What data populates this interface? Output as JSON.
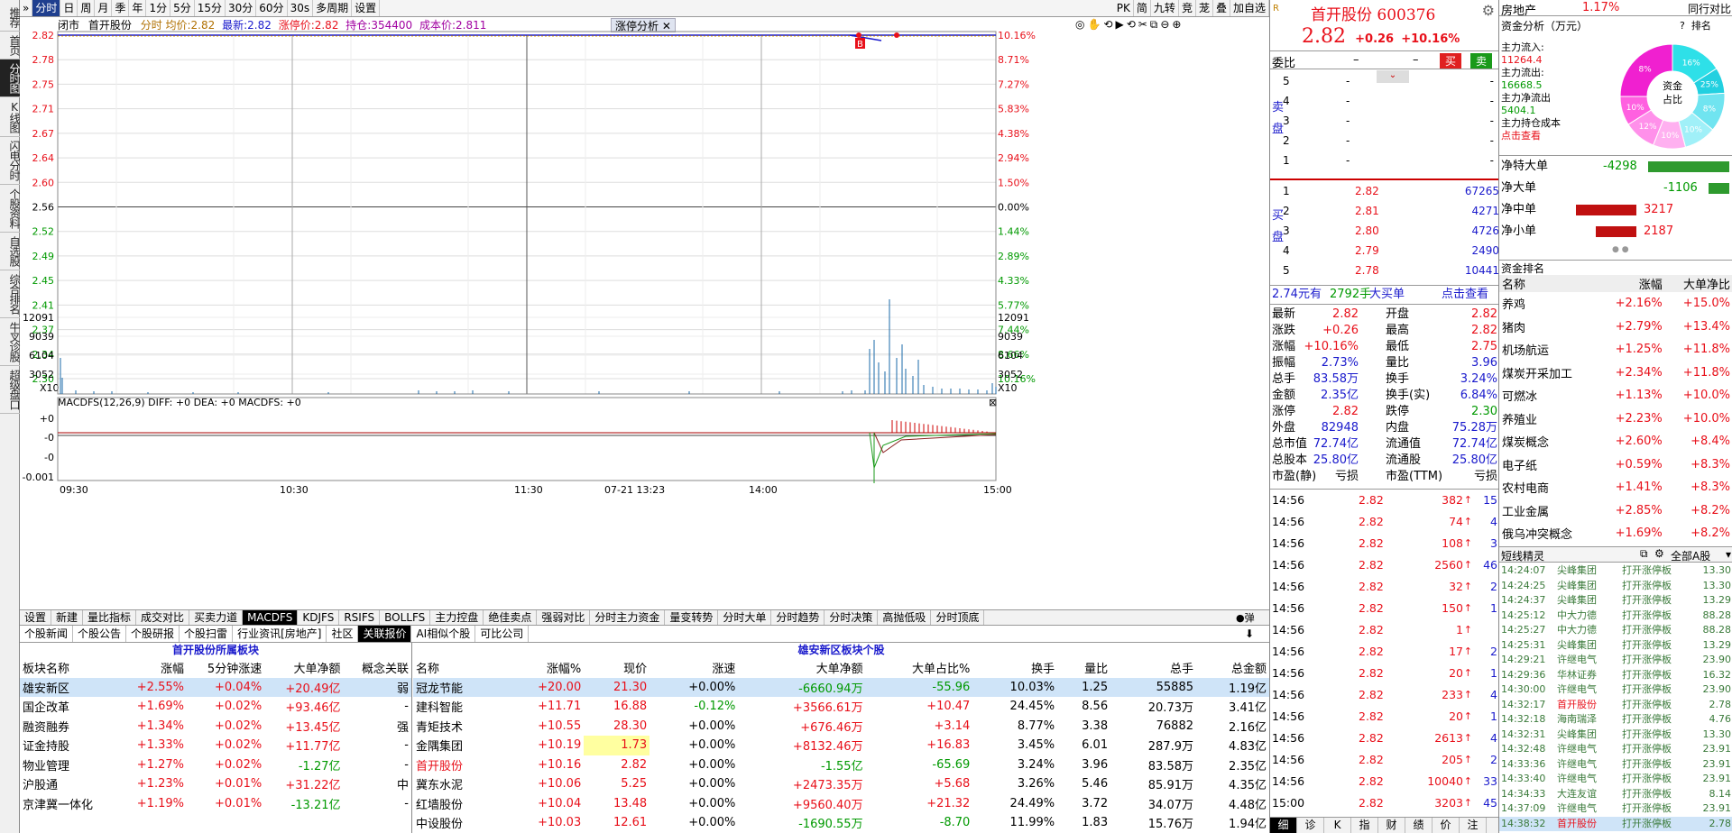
{
  "left_rail": [
    {
      "label": "推荐"
    },
    {
      "label": "首页"
    },
    {
      "label": "分时图",
      "active": true
    },
    {
      "label": "K线图"
    },
    {
      "label": "闪电分时"
    },
    {
      "label": "个股资料"
    },
    {
      "label": "自选股"
    },
    {
      "label": "综合排名"
    },
    {
      "label": "牛叉诊股"
    },
    {
      "label": "超级盘口"
    }
  ],
  "toolbar": {
    "items": [
      "分时",
      "日",
      "周",
      "月",
      "季",
      "年",
      "1分",
      "5分",
      "15分",
      "30分",
      "60分",
      "30s",
      "多周期",
      "设置"
    ],
    "right_items": [
      "PK",
      "简",
      "九转",
      "竞",
      "茏",
      "叠",
      "加自选"
    ]
  },
  "chart_header": {
    "mode": "闭市",
    "name": "首开股份",
    "avg_label": "分时 均价:",
    "avg": "2.82",
    "latest_label": "最新:",
    "latest": "2.82",
    "limit_label": "涨停价:",
    "limit": "2.82",
    "hold_label": "持仓:",
    "hold": "354400",
    "cost_label": "成本价:",
    "cost": "2.811",
    "analysis_btn": "涨停分析"
  },
  "price_axis": {
    "left": [
      "2.82",
      "2.78",
      "2.75",
      "2.71",
      "2.67",
      "2.64",
      "2.60",
      "2.56",
      "2.52",
      "2.49",
      "2.45",
      "2.41",
      "2.37",
      "2.34",
      "2.30"
    ],
    "right": [
      "10.16%",
      "8.71%",
      "7.27%",
      "5.83%",
      "4.38%",
      "2.94%",
      "1.50%",
      "0.00%",
      "1.44%",
      "2.89%",
      "4.33%",
      "5.77%",
      "7.44%",
      "8.66%",
      "10.16%"
    ]
  },
  "volume_axis": {
    "labels": [
      "12091",
      "9039",
      "6104",
      "3052"
    ],
    "unit": "X10"
  },
  "macd": {
    "title": "MACDFS(12,26,9) DIFF: +0 DEA: +0 MACDFS: +0",
    "labels": [
      "+0",
      "-0",
      "-0",
      "-0.001"
    ]
  },
  "time_axis": [
    "09:30",
    "10:30",
    "11:30",
    "07-21 13:23",
    "14:00",
    "15:00"
  ],
  "bottom_tabs": [
    "设置",
    "新建",
    "量比指标",
    "成交对比",
    "买卖力道",
    "MACDFS",
    "KDJFS",
    "RSIFS",
    "BOLLFS",
    "主力控盘",
    "绝佳卖点",
    "强弱对比",
    "分时主力资金",
    "量变转势",
    "分时大单",
    "分时趋势",
    "分时决策",
    "高抛低吸",
    "分时顶底"
  ],
  "bottom_tabs_active": "MACDFS",
  "sub_tabs": [
    "个股新闻",
    "个股公告",
    "个股研报",
    "个股扫雷",
    "行业资讯[房地产]",
    "社区",
    "关联报价",
    "AI相似个股",
    "可比公司"
  ],
  "sub_tabs_active": "关联报价",
  "sector_table": {
    "title": "首开股份所属板块",
    "headers": [
      "板块名称",
      "涨幅",
      "5分钟涨速",
      "大单净额",
      "概念关联"
    ],
    "rows": [
      [
        "雄安新区",
        "+2.55%",
        "+0.04%",
        "+20.49亿",
        "弱"
      ],
      [
        "国企改革",
        "+1.69%",
        "+0.02%",
        "+93.46亿",
        "-"
      ],
      [
        "融资融券",
        "+1.34%",
        "+0.02%",
        "+13.45亿",
        "强"
      ],
      [
        "证金持股",
        "+1.33%",
        "+0.02%",
        "+11.77亿",
        "-"
      ],
      [
        "物业管理",
        "+1.27%",
        "+0.02%",
        "-1.27亿",
        "-"
      ],
      [
        "沪股通",
        "+1.23%",
        "+0.01%",
        "+31.22亿",
        "中"
      ],
      [
        "京津冀一体化",
        "+1.19%",
        "+0.01%",
        "-13.21亿",
        "-"
      ]
    ]
  },
  "stock_table": {
    "title": "雄安新区板块个股",
    "headers": [
      "名称",
      "涨幅%",
      "现价",
      "涨速",
      "大单净额",
      "大单占比%",
      "换手",
      "量比",
      "总手",
      "总金额"
    ],
    "rows": [
      [
        "冠龙节能",
        "+20.00",
        "21.30",
        "+0.00%",
        "-6660.94万",
        "-55.96",
        "10.03%",
        "1.25",
        "55885",
        "1.19亿"
      ],
      [
        "建科智能",
        "+11.71",
        "16.88",
        "-0.12%",
        "+3566.61万",
        "+10.47",
        "24.45%",
        "8.56",
        "20.73万",
        "3.41亿"
      ],
      [
        "青矩技术",
        "+10.55",
        "28.30",
        "+0.00%",
        "+676.46万",
        "+3.14",
        "8.77%",
        "3.38",
        "76882",
        "2.16亿"
      ],
      [
        "金隅集团",
        "+10.19",
        "1.73",
        "+0.00%",
        "+8132.46万",
        "+16.83",
        "3.45%",
        "6.01",
        "287.9万",
        "4.83亿"
      ],
      [
        "首开股份",
        "+10.16",
        "2.82",
        "+0.00%",
        "-1.55亿",
        "-65.69",
        "3.24%",
        "3.96",
        "83.58万",
        "2.35亿"
      ],
      [
        "冀东水泥",
        "+10.06",
        "5.25",
        "+0.00%",
        "+2473.35万",
        "+5.68",
        "3.26%",
        "5.46",
        "85.91万",
        "4.35亿"
      ],
      [
        "红墙股份",
        "+10.04",
        "13.48",
        "+0.00%",
        "+9560.40万",
        "+21.32",
        "24.49%",
        "3.72",
        "34.07万",
        "4.48亿"
      ],
      [
        "中设股份",
        "+10.03",
        "12.61",
        "+0.00%",
        "-1690.55万",
        "-8.70",
        "11.99%",
        "1.83",
        "15.76万",
        "1.94亿"
      ]
    ]
  },
  "quote": {
    "name": "首开股份",
    "code": "600376",
    "price": "2.82",
    "change": "+0.26",
    "pct": "+10.16%",
    "weibi_label": "委比",
    "buy_btn": "买",
    "sell_btn": "卖"
  },
  "asks": [
    {
      "lvl": "5",
      "p": "-",
      "v": "-"
    },
    {
      "lvl": "4",
      "p": "-",
      "v": "-"
    },
    {
      "lvl": "3",
      "p": "-",
      "v": "-"
    },
    {
      "lvl": "2",
      "p": "-",
      "v": "-"
    },
    {
      "lvl": "1",
      "p": "-",
      "v": "-"
    }
  ],
  "bids": [
    {
      "lvl": "1",
      "p": "2.82",
      "v": "67265"
    },
    {
      "lvl": "2",
      "p": "2.81",
      "v": "4271"
    },
    {
      "lvl": "3",
      "p": "2.80",
      "v": "4726"
    },
    {
      "lvl": "4",
      "p": "2.79",
      "v": "2490"
    },
    {
      "lvl": "5",
      "p": "2.78",
      "v": "10441"
    }
  ],
  "big_buy": {
    "amount": "2.74元有",
    "hands": "2792手",
    "label": "大买单",
    "link": "点击查看"
  },
  "stats": [
    [
      "最新",
      "2.82",
      "开盘",
      "2.82"
    ],
    [
      "涨跌",
      "+0.26",
      "最高",
      "2.82"
    ],
    [
      "涨幅",
      "+10.16%",
      "最低",
      "2.75"
    ],
    [
      "振幅",
      "2.73%",
      "量比",
      "3.96"
    ],
    [
      "总手",
      "83.58万",
      "换手",
      "3.24%"
    ],
    [
      "金额",
      "2.35亿",
      "换手(实)",
      "6.84%"
    ],
    [
      "涨停",
      "2.82",
      "跌停",
      "2.30"
    ],
    [
      "外盘",
      "82948",
      "内盘",
      "75.28万"
    ],
    [
      "总市值",
      "72.74亿",
      "流通值",
      "72.74亿"
    ],
    [
      "总股本",
      "25.80亿",
      "流通股",
      "25.80亿"
    ],
    [
      "市盈(静)",
      "亏损",
      "市盈(TTM)",
      "亏损"
    ]
  ],
  "ticks": [
    [
      "14:56",
      "2.82",
      "382",
      "15"
    ],
    [
      "14:56",
      "2.82",
      "74",
      "4"
    ],
    [
      "14:56",
      "2.82",
      "108",
      "3"
    ],
    [
      "14:56",
      "2.82",
      "2560",
      "46"
    ],
    [
      "14:56",
      "2.82",
      "32",
      "2"
    ],
    [
      "14:56",
      "2.82",
      "150",
      "1"
    ],
    [
      "14:56",
      "2.82",
      "1",
      ""
    ],
    [
      "14:56",
      "2.82",
      "17",
      "2"
    ],
    [
      "14:56",
      "2.82",
      "20",
      "1"
    ],
    [
      "14:56",
      "2.82",
      "233",
      "4"
    ],
    [
      "14:56",
      "2.82",
      "20",
      "1"
    ],
    [
      "14:56",
      "2.82",
      "2613",
      "4"
    ],
    [
      "14:56",
      "2.82",
      "205",
      "2"
    ],
    [
      "14:56",
      "2.82",
      "10040",
      "33"
    ],
    [
      "15:00",
      "2.82",
      "3203",
      "45"
    ]
  ],
  "detail_tabs": [
    "细",
    "诊",
    "K",
    "指",
    "财",
    "绩",
    "价",
    "注"
  ],
  "fund": {
    "industry": "房地产",
    "industry_pct": "1.17%",
    "peer_label": "同行对比",
    "title": "资金分析（万元）",
    "help": "?",
    "all": "排名",
    "main_in_label": "主力流入:",
    "main_in": "11264.4",
    "main_out_label": "主力流出:",
    "main_out": "16668.5",
    "main_net_label": "主力净流出",
    "main_net": "5404.1",
    "main_cost_label": "主力持仓成本",
    "main_cost_link": "点击查看",
    "donut_label_1": "资金",
    "donut_label_2": "占比",
    "donut_pcts": [
      "16%",
      "25%",
      "8%",
      "10%",
      "10%",
      "12%",
      "10%",
      "8%"
    ],
    "net": [
      {
        "label": "净特大单",
        "value": "-4298",
        "frac": 0.5,
        "color": "#2e9a2e",
        "neg": true
      },
      {
        "label": "净大单",
        "value": "-1106",
        "frac": 0.13,
        "color": "#2e9a2e",
        "neg": true
      },
      {
        "label": "净中单",
        "value": "3217",
        "frac": 0.37,
        "color": "#c01010",
        "neg": false
      },
      {
        "label": "净小单",
        "value": "2187",
        "frac": 0.25,
        "color": "#c01010",
        "neg": false
      }
    ]
  },
  "fund_rank": {
    "title": "资金排名",
    "headers": [
      "名称",
      "涨幅",
      "大单净比"
    ],
    "rows": [
      [
        "养鸡",
        "+2.16%",
        "+15.0%"
      ],
      [
        "猪肉",
        "+2.79%",
        "+13.4%"
      ],
      [
        "机场航运",
        "+1.25%",
        "+11.8%"
      ],
      [
        "煤炭开采加工",
        "+2.34%",
        "+11.8%"
      ],
      [
        "可燃冰",
        "+1.13%",
        "+10.0%"
      ],
      [
        "养殖业",
        "+2.23%",
        "+10.0%"
      ],
      [
        "煤炭概念",
        "+2.60%",
        "+8.4%"
      ],
      [
        "电子纸",
        "+0.59%",
        "+8.3%"
      ],
      [
        "农村电商",
        "+1.41%",
        "+8.3%"
      ],
      [
        "工业金属",
        "+2.85%",
        "+8.2%"
      ],
      [
        "俄乌冲突概念",
        "+1.69%",
        "+8.2%"
      ]
    ]
  },
  "sprite": {
    "title": "短线精灵",
    "scope": "全部A股",
    "rows": [
      [
        "14:24:07",
        "尖峰集团",
        "打开涨停板",
        "13.30"
      ],
      [
        "14:24:25",
        "尖峰集团",
        "打开涨停板",
        "13.30"
      ],
      [
        "14:24:37",
        "尖峰集团",
        "打开涨停板",
        "13.29"
      ],
      [
        "14:25:12",
        "中大力德",
        "打开涨停板",
        "88.28"
      ],
      [
        "14:25:27",
        "中大力德",
        "打开涨停板",
        "88.28"
      ],
      [
        "14:25:31",
        "尖峰集团",
        "打开涨停板",
        "13.29"
      ],
      [
        "14:29:21",
        "许继电气",
        "打开涨停板",
        "23.90"
      ],
      [
        "14:29:36",
        "华林证券",
        "打开涨停板",
        "16.32"
      ],
      [
        "14:30:00",
        "许继电气",
        "打开涨停板",
        "23.90"
      ],
      [
        "14:32:17",
        "首开股份",
        "打开涨停板",
        "2.78"
      ],
      [
        "14:32:18",
        "海南瑞泽",
        "打开涨停板",
        "4.76"
      ],
      [
        "14:32:31",
        "尖峰集团",
        "打开涨停板",
        "13.30"
      ],
      [
        "14:32:48",
        "许继电气",
        "打开涨停板",
        "23.91"
      ],
      [
        "14:33:36",
        "许继电气",
        "打开涨停板",
        "23.91"
      ],
      [
        "14:33:40",
        "许继电气",
        "打开涨停板",
        "23.91"
      ],
      [
        "14:34:33",
        "大连友谊",
        "打开涨停板",
        "8.14"
      ],
      [
        "14:37:09",
        "许继电气",
        "打开涨停板",
        "23.91"
      ],
      [
        "14:38:32",
        "首开股份",
        "打开涨停板",
        "2.78"
      ]
    ]
  }
}
